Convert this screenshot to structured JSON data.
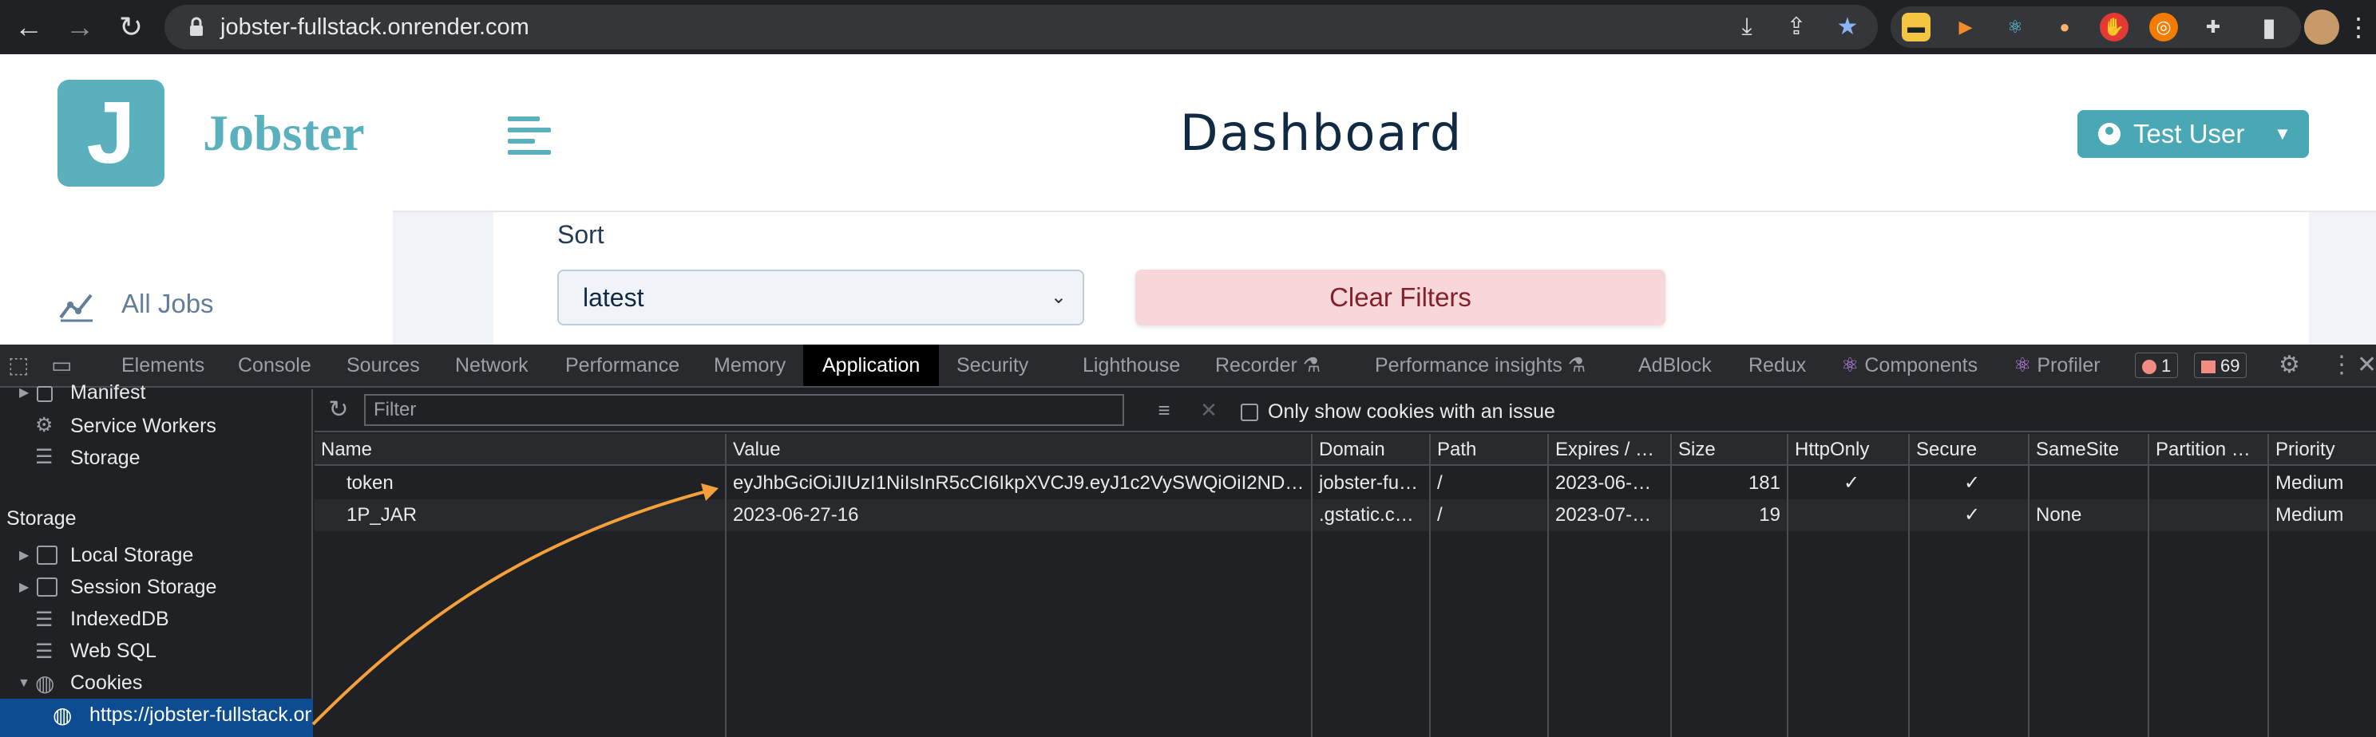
{
  "browser": {
    "url": "jobster-fullstack.onrender.com"
  },
  "app": {
    "logo_letter": "J",
    "logo_text": "Jobster",
    "page_title": "Dashboard",
    "user_label": "Test User",
    "nav_all_jobs": "All Jobs",
    "sort_label": "Sort",
    "sort_value": "latest",
    "clear_filters": "Clear Filters"
  },
  "devtools": {
    "tabs": [
      "Elements",
      "Console",
      "Sources",
      "Network",
      "Performance",
      "Memory",
      "Application",
      "Security",
      "Lighthouse",
      "Recorder",
      "Performance insights",
      "AdBlock",
      "Redux",
      "Components",
      "Profiler"
    ],
    "active_tab": "Application",
    "error_count": "1",
    "warning_count": "69",
    "sidebar": {
      "manifest": "Manifest",
      "service_workers": "Service Workers",
      "storage_item": "Storage",
      "storage_section": "Storage",
      "local_storage": "Local Storage",
      "session_storage": "Session Storage",
      "indexeddb": "IndexedDB",
      "websql": "Web SQL",
      "cookies": "Cookies",
      "cookie_origin": "https://jobster-fullstack.on"
    },
    "filter_placeholder": "Filter",
    "only_issue_label": "Only show cookies with an issue",
    "columns": [
      "Name",
      "Value",
      "Domain",
      "Path",
      "Expires / …",
      "Size",
      "HttpOnly",
      "Secure",
      "SameSite",
      "Partition …",
      "Priority"
    ],
    "rows": [
      {
        "name": "token",
        "value": "eyJhbGciOiJIUzI1NiIsInR5cCI6IkpXVCJ9.eyJ1c2VySWQiOiI2ND…",
        "domain": "jobster-fu…",
        "path": "/",
        "expires": "2023-06-…",
        "size": "181",
        "httponly": "✓",
        "secure": "✓",
        "samesite": "",
        "partition": "",
        "priority": "Medium"
      },
      {
        "name": "1P_JAR",
        "value": "2023-06-27-16",
        "domain": ".gstatic.c…",
        "path": "/",
        "expires": "2023-07-…",
        "size": "19",
        "httponly": "",
        "secure": "✓",
        "samesite": "None",
        "partition": "",
        "priority": "Medium"
      }
    ]
  },
  "colors": {
    "brand": "#5ab0bc",
    "annotation_arrow": "#f5a03a",
    "devtools_bg": "#202124",
    "selection": "#0e4c91"
  }
}
